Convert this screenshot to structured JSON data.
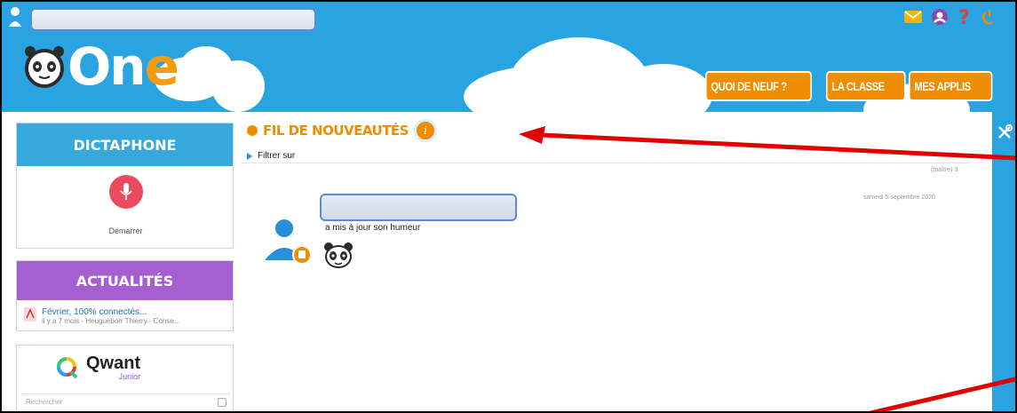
{
  "topbar": {
    "icons": [
      "user-icon",
      "mail-icon",
      "account-icon",
      "help-icon",
      "power-icon"
    ],
    "icon_colors": {
      "mail": "#f0b400",
      "account": "#8e44ad",
      "help": "#e63946",
      "power": "#f08c00"
    }
  },
  "logo": {
    "text_main": "On",
    "text_accent": "e"
  },
  "nav": {
    "items": [
      "QUOI DE NEUF ?",
      "LA CLASSE",
      "MES APPLIS"
    ]
  },
  "widgets": {
    "dictaphone": {
      "title": "DICTAPHONE",
      "start_label": "Démarrer"
    },
    "actualites": {
      "title": "ACTUALITÉS",
      "item_title": "Février, 100% connectés...",
      "item_meta": "il y a 7 mois - Heugueborr Thierry - Conse..."
    },
    "qwant": {
      "brand": "Qwant",
      "sub": "Junior",
      "placeholder": "Rechercher"
    }
  },
  "feed": {
    "title": "FIL DE NOUVEAUTÉS",
    "info": "i",
    "filter_label": "Filtrer sur",
    "meta_right": "(maître) 3",
    "date": "samedi 5 septembre 2020",
    "entry_text": "a mis à jour son humeur"
  },
  "colors": {
    "brand_blue": "#2aa4e0",
    "accent_orange": "#f08c00",
    "actu_purple": "#a55fd0",
    "annotation_red": "#e00000"
  }
}
